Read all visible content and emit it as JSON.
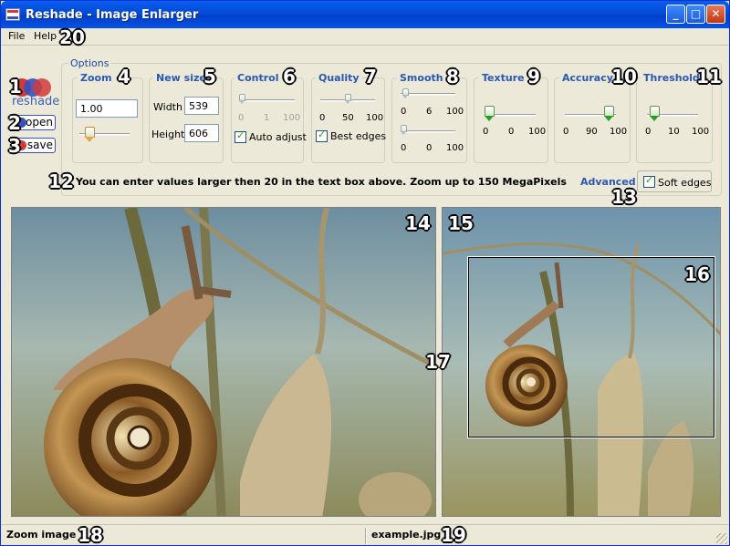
{
  "window": {
    "title": "Reshade - Image Enlarger",
    "accent": "#0148d1"
  },
  "menu": {
    "file": "File",
    "help": "Help"
  },
  "logo": {
    "text": "reshade"
  },
  "buttons": {
    "open": "open",
    "save": "save"
  },
  "options": {
    "legend": "Options",
    "zoom": {
      "title": "Zoom",
      "value": "1.00"
    },
    "new_size": {
      "title": "New size",
      "width_label": "Width",
      "width_value": "539",
      "height_label": "Height",
      "height_value": "606"
    },
    "control": {
      "title": "Control",
      "ticks": [
        "0",
        "1",
        "100"
      ],
      "auto_adjust_label": "Auto adjust",
      "auto_adjust_checked": true
    },
    "quality": {
      "title": "Quality",
      "ticks": [
        "0",
        "50",
        "100"
      ],
      "best_edges_label": "Best edges",
      "best_edges_checked": true
    },
    "smooth": {
      "title": "Smooth",
      "ticks_top": [
        "0",
        "6",
        "100"
      ],
      "ticks_bottom": [
        "0",
        "0",
        "100"
      ]
    },
    "texture": {
      "title": "Texture",
      "ticks": [
        "0",
        "0",
        "100"
      ]
    },
    "accuracy": {
      "title": "Accuracy",
      "ticks": [
        "0",
        "90",
        "100"
      ]
    },
    "threshold": {
      "title": "Threshold",
      "ticks": [
        "0",
        "10",
        "100"
      ]
    }
  },
  "info_text": "You can enter values larger then 20 in the text box above. Zoom up to 150 MegaPixels",
  "advanced_label": "Advanced",
  "soft_edges": {
    "label": "Soft edges",
    "checked": true
  },
  "status": {
    "left": "Zoom image",
    "right": "example.jpg"
  },
  "callouts": {
    "c1": "1",
    "c2": "2",
    "c3": "3",
    "c4": "4",
    "c5": "5",
    "c6": "6",
    "c7": "7",
    "c8": "8",
    "c9": "9",
    "c10": "10",
    "c11": "11",
    "c12": "12",
    "c13": "13",
    "c14": "14",
    "c15": "15",
    "c16": "16",
    "c17": "17",
    "c18": "18",
    "c19": "19",
    "c20": "20"
  }
}
